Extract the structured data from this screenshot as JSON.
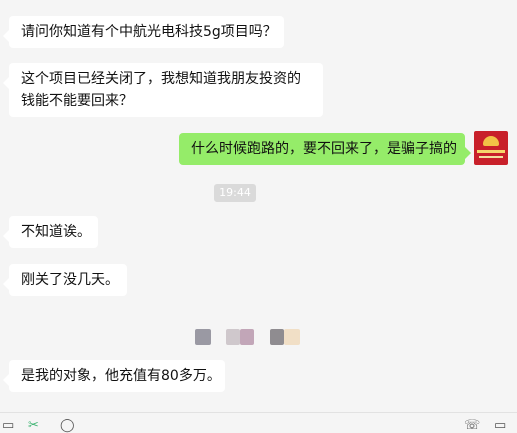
{
  "messages": [
    {
      "side": "left",
      "text": "请问你知道有个中航光电科技5g项目吗？"
    },
    {
      "side": "left",
      "text": "这个项目已经关闭了，我想知道我朋友投资的钱能不能要回来？"
    },
    {
      "side": "right",
      "text": "什么时候跑路的，要不回来了，是骗子搞的"
    },
    {
      "side": "left",
      "text": "不知道诶。"
    },
    {
      "side": "left",
      "text": "刚关了没几天。"
    },
    {
      "side": "left",
      "text": "是我的对象，他充值有80多万。"
    }
  ],
  "timestamp": "19:44",
  "colors": {
    "background": "#f5f5f5",
    "bubble_left": "#ffffff",
    "bubble_right": "#95ec69",
    "timestamp_bg": "#dadada"
  },
  "icons": [
    "folder-icon",
    "scissors-icon",
    "chat-history-icon",
    "phone-icon",
    "video-call-icon"
  ]
}
